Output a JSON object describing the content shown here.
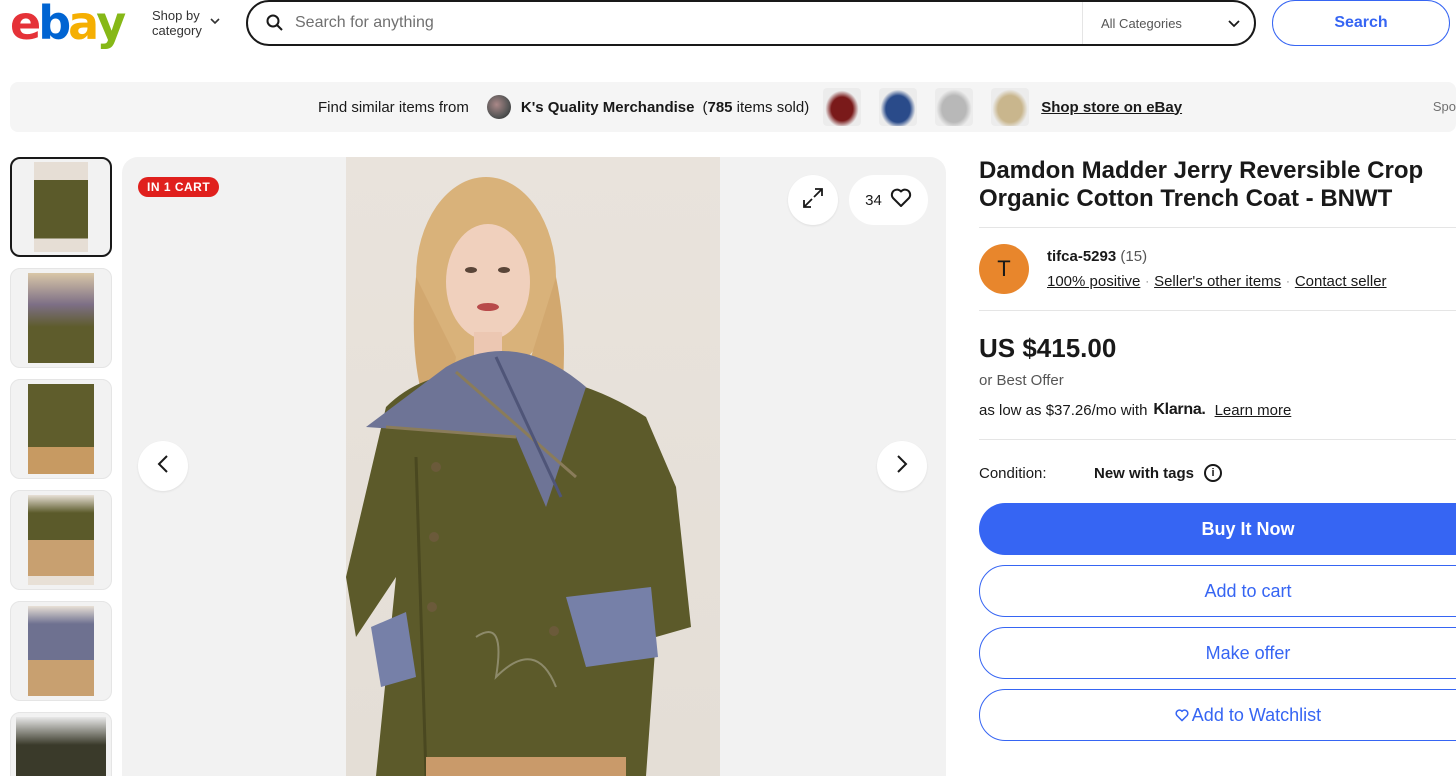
{
  "header": {
    "logo_letters": [
      "e",
      "b",
      "a",
      "y"
    ],
    "logo_colors": [
      "#e53238",
      "#0064d2",
      "#f5af02",
      "#86b817"
    ],
    "shop_by_line1": "Shop by",
    "shop_by_line2": "category",
    "search_placeholder": "Search for anything",
    "category_select": "All Categories",
    "search_button": "Search"
  },
  "store_banner": {
    "find_text": "Find similar items from",
    "store_name": "K's Quality Merchandise",
    "sold_open": "(",
    "sold_count": "785",
    "sold_suffix": " items sold)",
    "shop_link": "Shop store on eBay",
    "sponsored_cut": "Spo"
  },
  "gallery": {
    "badge": "IN 1 CART",
    "watch_count": "34",
    "thumbnail_count": 6
  },
  "listing": {
    "title": "Damdon Madder Jerry Reversible Crop Organic Cotton Trench Coat - BNWT",
    "seller": {
      "avatar_letter": "T",
      "name": "tifca-5293",
      "feedback_count": "(15)",
      "positive": "100% positive",
      "other_items": "Seller's other items",
      "contact": "Contact seller"
    },
    "price": "US $415.00",
    "best_offer": "or Best Offer",
    "klarna_prefix": "as low as $37.26/mo with",
    "klarna_brand": "Klarna.",
    "klarna_learn": "Learn more",
    "condition_label": "Condition:",
    "condition_value": "New with tags",
    "buy_now": "Buy It Now",
    "add_to_cart": "Add to cart",
    "make_offer": "Make offer",
    "watchlist": "Add to Watchlist"
  },
  "colors": {
    "accent": "#3665f3",
    "badge_red": "#e0201d",
    "avatar_orange": "#e8862c"
  },
  "icons": [
    "search-icon",
    "chevron-down-icon",
    "expand-icon",
    "heart-icon",
    "chevron-left-icon",
    "chevron-right-icon",
    "info-icon"
  ]
}
